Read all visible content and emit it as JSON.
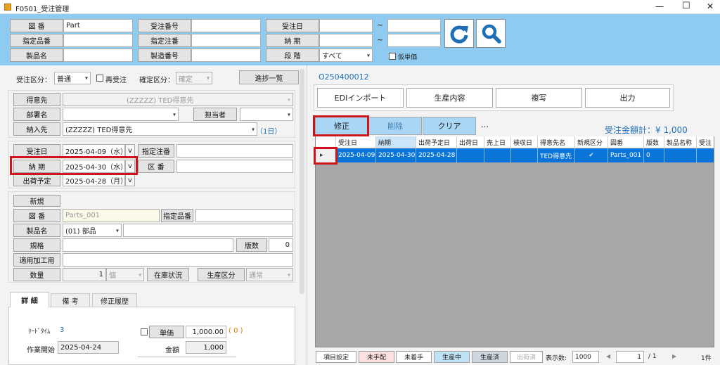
{
  "window": {
    "title": "F0501_受注管理",
    "minimize": "—",
    "maximize": "☐",
    "close": "✕"
  },
  "search": {
    "labels": {
      "zuban": "図 番",
      "shitei_hinban": "指定品番",
      "seihinmei": "製品名",
      "juchu_bango": "受注番号",
      "shitei_chuban": "指定注番",
      "seizo_bango": "製造番号",
      "juchubi": "受注日",
      "nouki": "納 期",
      "dankai": "段 階"
    },
    "zuban_value": "Part",
    "tilde": "~",
    "dankai_value": "すべて",
    "kari_tanka_label": "仮単価"
  },
  "left": {
    "juchu_kubun_label": "受注区分：",
    "juchu_kubun_value": "普通",
    "sai_juchu_label": "再受注",
    "kakutei_kubun_label": "確定区分：",
    "kakutei_kubun_value": "確定",
    "shincho_button": "進捗一覧",
    "tokuisaki_label": "得意先",
    "tokuisaki_value": "(ZZZZZ) TED得意先",
    "bushomei_label": "部署名",
    "tantosha_label": "担当者",
    "nyunyusaki_label": "納入先",
    "nyunyusaki_value": "(ZZZZZ) TED得意先",
    "nyunyusaki_days": "（1日）",
    "juchubi_label": "受注日",
    "juchubi_value": "2025-04-09（水）",
    "shitei_chuban_label": "指定注番",
    "nouki_label": "納 期",
    "nouki_value": "2025-04-30（水）",
    "kuban_label": "区 番",
    "shukka_label": "出荷予定",
    "shukka_value": "2025-04-28（月）",
    "v": "v",
    "shinki_label": "新規",
    "zuban_label": "図 番",
    "zuban_value": "Parts_001",
    "shitei_hinban_label": "指定品番",
    "seihinmei_label": "製品名",
    "seihinmei_value": "(01) 部品",
    "kikaku_label": "規格",
    "hansu_label": "版数",
    "hansu_value": "0",
    "tekiyo_label": "適用加工用",
    "suryo_label": "数量",
    "suryo_value": "1",
    "unit_value": "個",
    "zaiko_button": "在庫状況",
    "seisan_kubun_label": "生産区分",
    "seisan_kubun_value": "通常",
    "tabs": [
      "詳 細",
      "備 考",
      "修正履歴"
    ],
    "lead_time_label": "ﾘｰﾄﾞﾀｲﾑ",
    "lead_time_value": "3",
    "sagyo_kaishi_label": "作業開始",
    "sagyo_kaishi_value": "2025-04-24",
    "tanka_label": "単価",
    "tanka_value": "1,000.00",
    "tanka_zero": "( 0 )",
    "kingaku_label": "金額",
    "kingaku_value": "1,000"
  },
  "right": {
    "order_no": "O250400012",
    "actions": [
      "EDIインポート",
      "生産内容",
      "複写",
      "出力"
    ],
    "edit_buttons": [
      "修正",
      "削除",
      "クリア"
    ],
    "more": "…",
    "total": "受注金額計：¥ 1,000",
    "grid": {
      "headers": [
        "受注日",
        "納期",
        "出荷予定日",
        "出荷日",
        "売上日",
        "検収日",
        "得意先名",
        "新規区分",
        "図番",
        "版数",
        "製品名称",
        "受注"
      ],
      "rows": [
        [
          "2025-04-09",
          "2025-04-30",
          "2025-04-28",
          "",
          "",
          "",
          "TED得意先",
          "✔",
          "Parts_001",
          "0",
          "",
          ""
        ]
      ],
      "row_marker": "▸"
    },
    "status": {
      "item_settings": "項目設定",
      "states": [
        "未手配",
        "未着手",
        "生産中",
        "生産済",
        "出荷済"
      ],
      "display_label": "表示数:",
      "display_value": "1000",
      "page_value": "1",
      "page_total": "/ 1",
      "count": "1件",
      "prev": "◀",
      "next": "▶"
    }
  },
  "colors": {
    "accent": "#0a74d8",
    "highlight": "#d0141e",
    "banner": "#8fcbf0",
    "selected_btn": "#a9d6f5"
  }
}
